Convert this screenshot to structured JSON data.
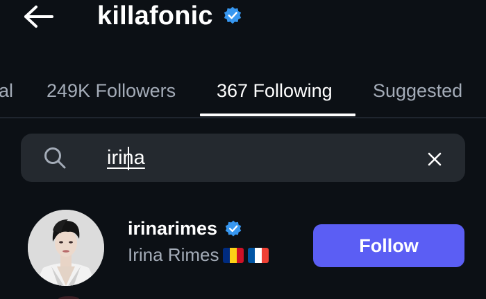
{
  "header": {
    "title": "killafonic",
    "verified": true,
    "back_icon": "arrow-left-icon"
  },
  "tabs": [
    {
      "label": "al",
      "active": false
    },
    {
      "label": "249K Followers",
      "active": false
    },
    {
      "label": "367 Following",
      "active": true
    },
    {
      "label": "Suggested",
      "active": false
    }
  ],
  "search": {
    "value": "irina",
    "search_icon": "search-icon",
    "clear_icon": "close-icon"
  },
  "results": [
    {
      "username": "irinarimes",
      "verified": true,
      "full_name": "Irina Rimes",
      "flags": [
        "Romania",
        "France"
      ],
      "button_label": "Follow"
    }
  ],
  "colors": {
    "background": "#0c1015",
    "verified_badge": "#3797f0",
    "follow_button": "#5b5ef4",
    "secondary_text": "#a4acb8",
    "search_bg": "#24292f"
  }
}
